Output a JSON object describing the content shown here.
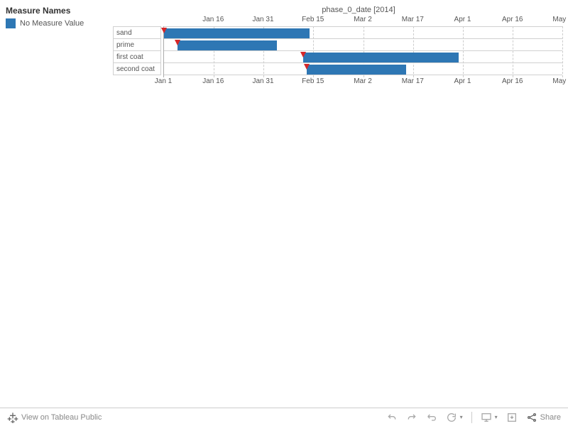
{
  "legend": {
    "title": "Measure Names",
    "items": [
      {
        "label": "No Measure Value",
        "color": "#2e77b4"
      }
    ]
  },
  "chart_data": {
    "type": "bar",
    "title": "phase_0_date [2014]",
    "xlabel": "",
    "ylabel": "",
    "x_ticks": [
      "Jan 1",
      "Jan 16",
      "Jan 31",
      "Feb 15",
      "Mar 2",
      "Mar 17",
      "Apr 1",
      "Apr 16",
      "May 1"
    ],
    "categories": [
      "sand",
      "prime",
      "first coat",
      "second coat"
    ],
    "series": [
      {
        "name": "No Measure Value",
        "bars": [
          {
            "category": "sand",
            "start": "Jan 1",
            "end": "Feb 14"
          },
          {
            "category": "prime",
            "start": "Jan 5",
            "end": "Feb 4"
          },
          {
            "category": "first coat",
            "start": "Feb 12",
            "end": "Mar 30"
          },
          {
            "category": "second coat",
            "start": "Feb 13",
            "end": "Mar 15"
          }
        ],
        "markers": [
          {
            "category": "sand",
            "date": "Jan 1"
          },
          {
            "category": "prime",
            "date": "Jan 5"
          },
          {
            "category": "first coat",
            "date": "Feb 12"
          },
          {
            "category": "second coat",
            "date": "Feb 13"
          }
        ]
      }
    ],
    "xlim": [
      "Jan 1",
      "May 1"
    ]
  },
  "toolbar": {
    "view_label": "View on Tableau Public",
    "share_label": "Share"
  }
}
